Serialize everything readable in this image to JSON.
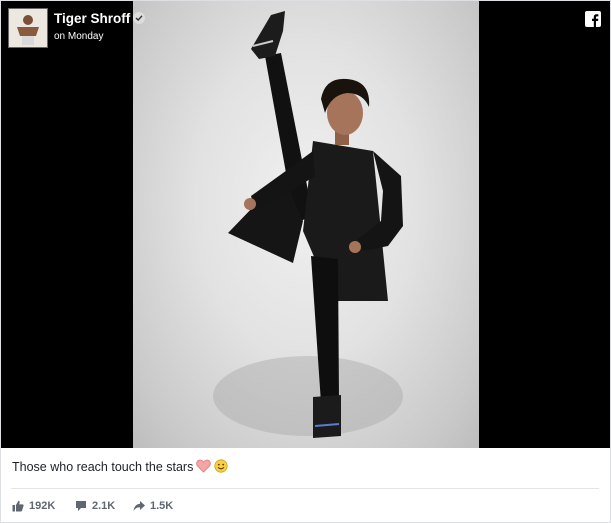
{
  "post": {
    "author": "Tiger Shroff",
    "time": "on Monday",
    "caption": "Those who reach touch the stars",
    "caption_emojis": [
      "heart-icon",
      "smile-icon"
    ],
    "stats": {
      "likes": "192K",
      "comments": "2.1K",
      "shares": "1.5K"
    }
  },
  "icons": {
    "facebook": "facebook-icon",
    "verified": "verified-badge-icon",
    "like": "thumbs-up-icon",
    "comment": "comment-icon",
    "share": "share-arrow-icon"
  },
  "colors": {
    "media_bg": "#000000",
    "text": "#1d2129",
    "meta": "#606770",
    "heart": "#f4a6a6",
    "smile": "#f7d046"
  }
}
